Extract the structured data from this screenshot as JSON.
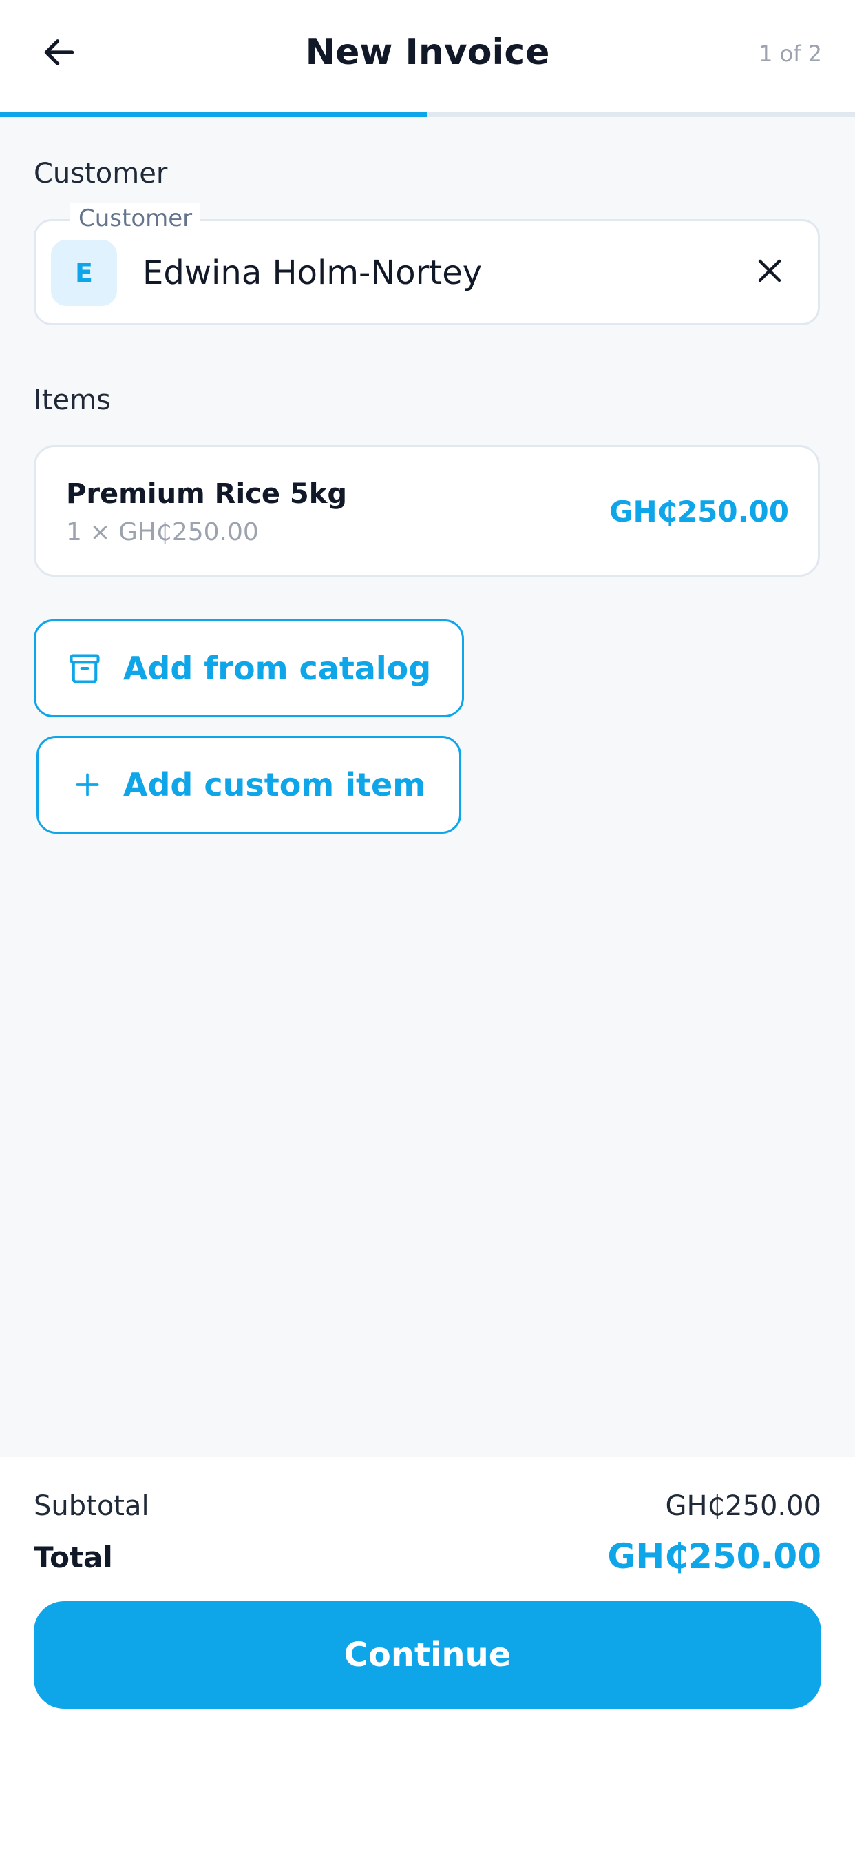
{
  "header": {
    "title": "New Invoice",
    "step": "1 of 2",
    "progress_fraction": 0.5,
    "accent_color": "#0EA5E9"
  },
  "customer_section": {
    "label": "Customer",
    "field_label": "Customer",
    "avatar_initial": "E",
    "customer_name": "Edwina Holm-Nortey"
  },
  "items_section": {
    "label": "Items",
    "items": [
      {
        "name": "Premium Rice 5kg",
        "qty_price": "1 × GH₵250.00",
        "amount": "GH₵250.00"
      }
    ]
  },
  "actions": {
    "add_from_catalog": "Add from catalog",
    "add_custom_item": "Add custom item"
  },
  "summary": {
    "subtotal_label": "Subtotal",
    "subtotal_value": "GH₵250.00",
    "total_label": "Total",
    "total_value": "GH₵250.00",
    "continue_label": "Continue"
  },
  "icons": {
    "back": "arrow-left-icon",
    "clear": "close-icon",
    "catalog": "archive-box-icon",
    "add": "plus-icon"
  }
}
